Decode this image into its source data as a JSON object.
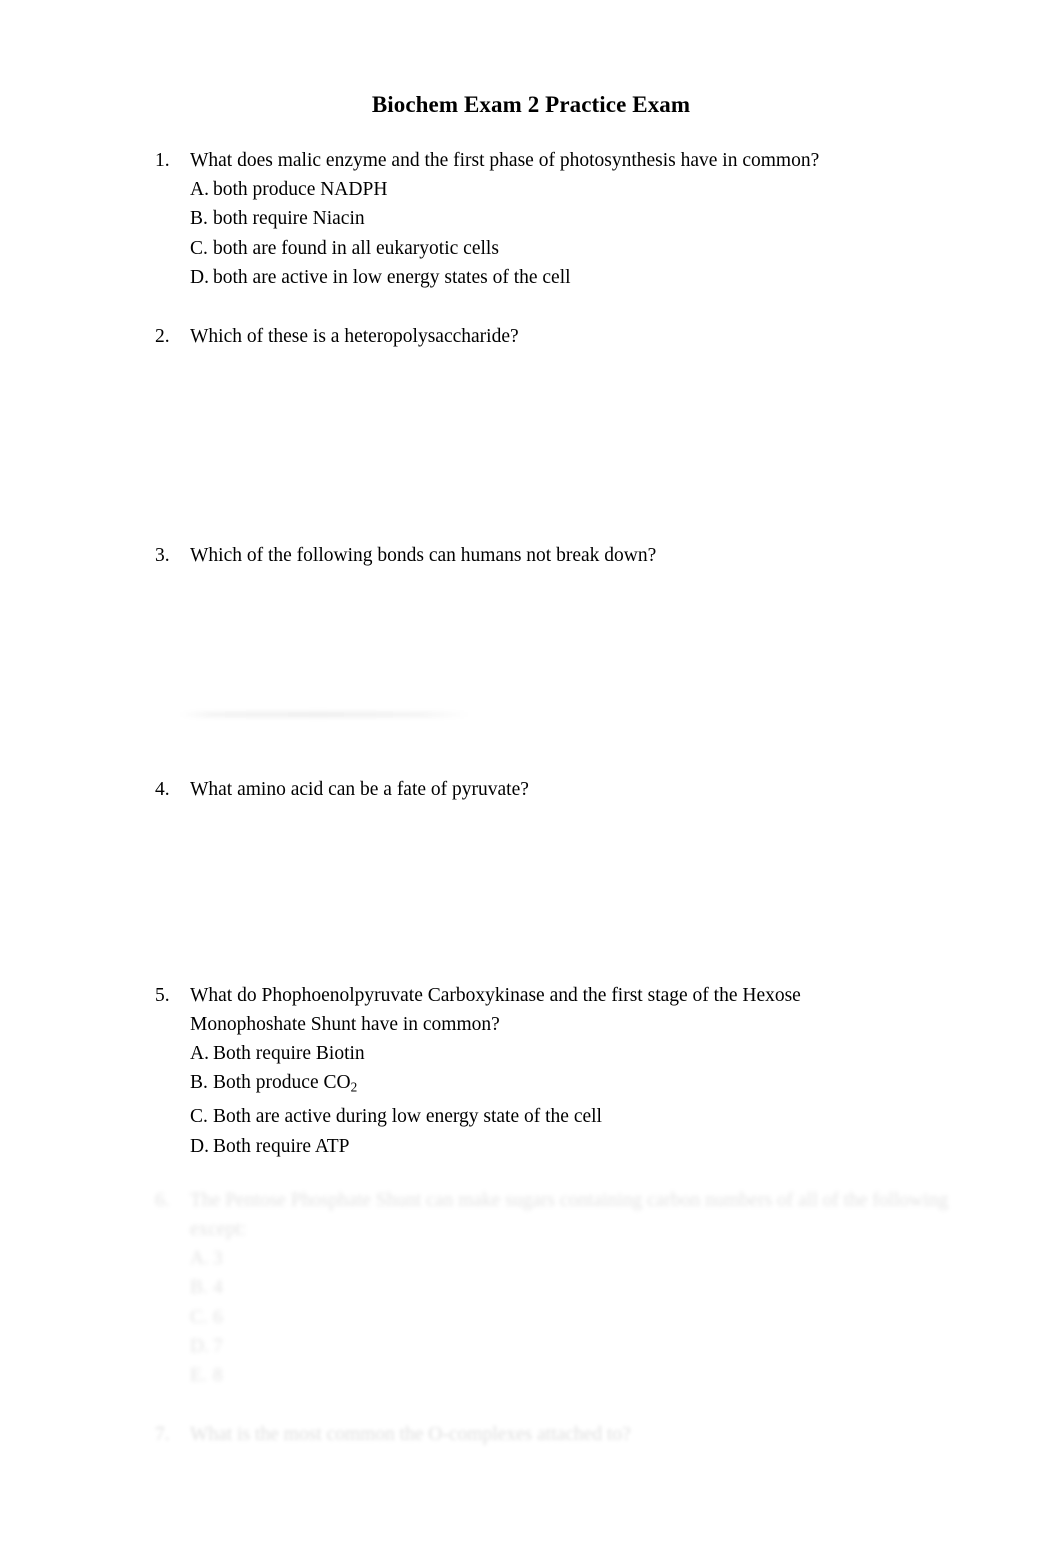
{
  "document": {
    "title": "Biochem Exam 2 Practice Exam"
  },
  "questions": [
    {
      "number": "1.",
      "stem": "What does malic enzyme and the first phase of photosynthesis have in common?",
      "options": [
        {
          "letter": "A.",
          "text": "both produce NADPH"
        },
        {
          "letter": "B.",
          "text": "both require Niacin"
        },
        {
          "letter": "C.",
          "text": "both are found in all eukaryotic cells"
        },
        {
          "letter": "D.",
          "text": "both are active in low energy states of the cell"
        }
      ]
    },
    {
      "number": "2.",
      "stem": "Which of these is a heteropolysaccharide?",
      "options": []
    },
    {
      "number": "3.",
      "stem": "Which of the following bonds can humans not break down?",
      "options": []
    },
    {
      "number": "4.",
      "stem": "What amino acid can be a fate of pyruvate?",
      "options": []
    },
    {
      "number": "5.",
      "stem_line_1": "What do Phophoenolpyruvate Carboxykinase and the first stage of the Hexose",
      "stem_line_2": "Monophoshate Shunt have in common?",
      "options": [
        {
          "letter": "A.",
          "text": "Both require Biotin"
        },
        {
          "letter": "B.",
          "text_before": "Both produce CO",
          "subscript": "2"
        },
        {
          "letter": "C.",
          "text": "Both are active during low energy state of the cell"
        },
        {
          "letter": "D.",
          "text": "Both require ATP"
        }
      ]
    },
    {
      "number": "6.",
      "legibility": "faded",
      "stem_line_1": "The Pentose Phosphate Shunt can make sugars containing carbon numbers of all of the following",
      "stem_line_2": "except:",
      "options": [
        {
          "letter": "A.",
          "text": "3"
        },
        {
          "letter": "B.",
          "text": "4"
        },
        {
          "letter": "C.",
          "text": "6"
        },
        {
          "letter": "D.",
          "text": "7"
        },
        {
          "letter": "E.",
          "text": "8"
        }
      ]
    },
    {
      "number": "7.",
      "legibility": "faded",
      "stem": "What is the most common the O-complexes attached to?",
      "options": []
    }
  ]
}
